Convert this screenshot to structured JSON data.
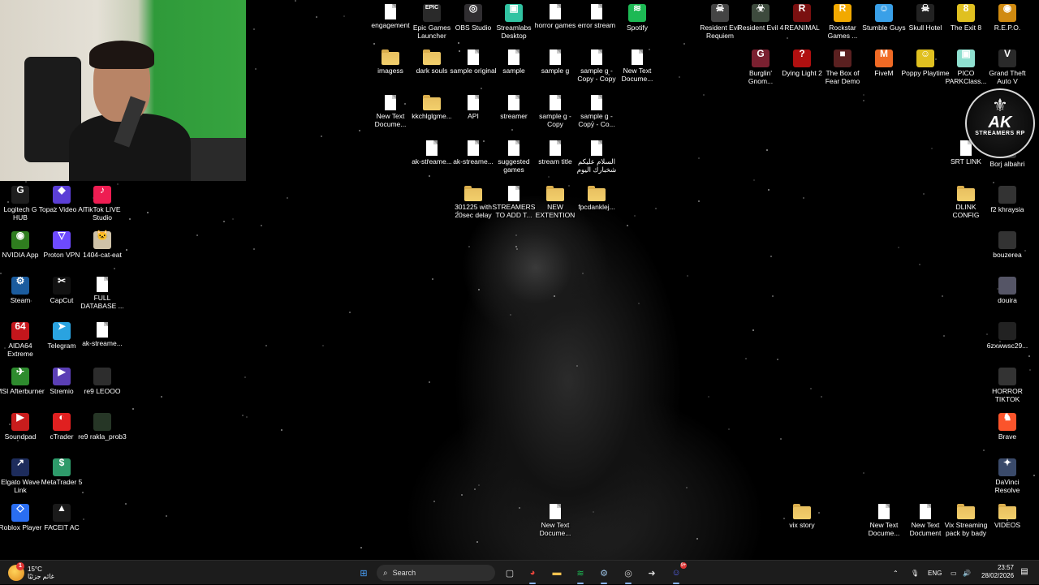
{
  "desktop": {
    "icons_left": [
      {
        "label": "Logitech G HUB",
        "icon": "logitech-icon",
        "color": "#1e1e1e",
        "glyph": "G"
      },
      {
        "label": "Topaz Video AI",
        "icon": "topaz-icon",
        "color": "#5b3fd6",
        "glyph": "◆"
      },
      {
        "label": "TikTok LIVE Studio",
        "icon": "tiktok-icon",
        "color": "#ee1d52",
        "glyph": "♪"
      },
      {
        "label": "NVIDIA App",
        "icon": "nvidia-icon",
        "color": "#2f7d1f",
        "glyph": "◉"
      },
      {
        "label": "Proton VPN",
        "icon": "proton-icon",
        "color": "#6d4aff",
        "glyph": "▽"
      },
      {
        "label": "1404-cat-eat",
        "icon": "image-icon",
        "color": "#cfc2a8",
        "glyph": "🐱"
      },
      {
        "label": "Steam",
        "icon": "steam-icon",
        "color": "#1b5c9e",
        "glyph": "⚙"
      },
      {
        "label": "CapCut",
        "icon": "capcut-icon",
        "color": "#111",
        "glyph": "✂"
      },
      {
        "label": "FULL DATABASE ...",
        "icon": "file-icon",
        "color": "",
        "glyph": ""
      },
      {
        "label": "AIDA64 Extreme",
        "icon": "aida-icon",
        "color": "#c4161c",
        "glyph": "64"
      },
      {
        "label": "Telegram",
        "icon": "telegram-icon",
        "color": "#2aa3e0",
        "glyph": "➤"
      },
      {
        "label": "ak-streame...",
        "icon": "file-icon",
        "color": "",
        "glyph": ""
      },
      {
        "label": "MSI Afterburner",
        "icon": "msi-icon",
        "color": "#2e8b2e",
        "glyph": "✈"
      },
      {
        "label": "Stremio",
        "icon": "stremio-icon",
        "color": "#5b3fb5",
        "glyph": "▶"
      },
      {
        "label": "re9 LEOOO",
        "icon": "image-icon",
        "color": "#2d2d2d",
        "glyph": ""
      },
      {
        "label": "Soundpad",
        "icon": "soundpad-icon",
        "color": "#c91d1d",
        "glyph": "▶"
      },
      {
        "label": "cTrader",
        "icon": "ctrader-icon",
        "color": "#e02020",
        "glyph": "◐"
      },
      {
        "label": "re9 rakla_prob3",
        "icon": "image-icon",
        "color": "#263626",
        "glyph": ""
      },
      {
        "label": "Elgato Wave Link",
        "icon": "elgato-icon",
        "color": "#1d2c5c",
        "glyph": "↗"
      },
      {
        "label": "MetaTrader 5",
        "icon": "metatrader-icon",
        "color": "#2e9a6a",
        "glyph": "$"
      },
      {
        "label": "Roblox Player",
        "icon": "roblox-icon",
        "color": "#2a6ef2",
        "glyph": "◇"
      },
      {
        "label": "FACEIT AC",
        "icon": "faceit-icon",
        "color": "#1a1a1a",
        "glyph": "▲"
      }
    ],
    "icons_middle": [
      {
        "label": "engagement",
        "icon": "file-icon",
        "type": "file"
      },
      {
        "label": "Epic Games Launcher",
        "icon": "epic-icon",
        "type": "app",
        "color": "#2a2a2a",
        "glyph": "EPIC"
      },
      {
        "label": "OBS Studio",
        "icon": "obs-icon",
        "type": "app",
        "color": "#302e31",
        "glyph": "◎"
      },
      {
        "label": "Streamlabs Desktop",
        "icon": "streamlabs-icon",
        "type": "app",
        "color": "#31c3a2",
        "glyph": "▣"
      },
      {
        "label": "horror games",
        "icon": "file-icon",
        "type": "file"
      },
      {
        "label": "error stream",
        "icon": "file-icon",
        "type": "file"
      },
      {
        "label": "Spotify",
        "icon": "spotify-icon",
        "type": "app",
        "color": "#1db954",
        "glyph": "≋"
      },
      {
        "label": "imagess",
        "icon": "folder-icon",
        "type": "folder"
      },
      {
        "label": "dark souls",
        "icon": "folder-icon",
        "type": "folder"
      },
      {
        "label": "sample original",
        "icon": "file-icon",
        "type": "file"
      },
      {
        "label": "sample",
        "icon": "file-icon",
        "type": "file"
      },
      {
        "label": "sample g",
        "icon": "file-icon",
        "type": "file"
      },
      {
        "label": "sample g - Copy - Copy",
        "icon": "file-icon",
        "type": "file"
      },
      {
        "label": "New Text Docume...",
        "icon": "file-icon",
        "type": "file"
      },
      {
        "label": "New Text Docume...",
        "icon": "file-icon",
        "type": "file"
      },
      {
        "label": "kkchlglgme...",
        "icon": "folder-icon",
        "type": "folder"
      },
      {
        "label": "API",
        "icon": "file-icon",
        "type": "file"
      },
      {
        "label": "streamer",
        "icon": "file-icon",
        "type": "file"
      },
      {
        "label": "sample g - Copy",
        "icon": "file-icon",
        "type": "file"
      },
      {
        "label": "sample g - Copy - Co...",
        "icon": "file-icon",
        "type": "file"
      },
      {
        "label": "ak-streame...",
        "icon": "file-icon",
        "type": "file"
      },
      {
        "label": "ak-streame...",
        "icon": "file-icon",
        "type": "file"
      },
      {
        "label": "suggested games",
        "icon": "file-icon",
        "type": "file"
      },
      {
        "label": "stream title",
        "icon": "file-icon",
        "type": "file"
      },
      {
        "label": "السلام عليكم شخبارك اليوم",
        "icon": "file-icon",
        "type": "file"
      },
      {
        "label": "301225 with 20sec delay",
        "icon": "folder-icon",
        "type": "folder"
      },
      {
        "label": "STREAMERS TO ADD T...",
        "icon": "file-icon",
        "type": "file"
      },
      {
        "label": "NEW EXTENTION",
        "icon": "folder-icon",
        "type": "folder"
      },
      {
        "label": "fpcdanklej...",
        "icon": "folder-icon",
        "type": "folder"
      },
      {
        "label": "New Text Docume...",
        "icon": "file-icon",
        "type": "file"
      }
    ],
    "icons_right": [
      {
        "label": "Resident Evil Requiem",
        "icon": "game-icon",
        "color": "#444",
        "glyph": "☠"
      },
      {
        "label": "Resident Evil 4",
        "icon": "game-icon",
        "color": "#3d4a3d",
        "glyph": "☣"
      },
      {
        "label": "REANIMAL",
        "icon": "game-icon",
        "color": "#7a1010",
        "glyph": "R"
      },
      {
        "label": "Rockstar Games ...",
        "icon": "rockstar-icon",
        "color": "#f2a900",
        "glyph": "R"
      },
      {
        "label": "Stumble Guys",
        "icon": "game-icon",
        "color": "#39a0e8",
        "glyph": "☺"
      },
      {
        "label": "Skull Hotel",
        "icon": "game-icon",
        "color": "#222",
        "glyph": "☠"
      },
      {
        "label": "The Exit 8",
        "icon": "game-icon",
        "color": "#e0c020",
        "glyph": "8"
      },
      {
        "label": "R.E.P.O.",
        "icon": "game-icon",
        "color": "#d08a10",
        "glyph": "◉"
      },
      {
        "label": "Burglin' Gnom...",
        "icon": "game-icon",
        "color": "#7a2030",
        "glyph": "G"
      },
      {
        "label": "Dying Light 2",
        "icon": "game-icon",
        "color": "#b01010",
        "glyph": "?"
      },
      {
        "label": "The Box of Fear Demo",
        "icon": "game-icon",
        "color": "#5a2020",
        "glyph": "■"
      },
      {
        "label": "FiveM",
        "icon": "fivem-icon",
        "color": "#f06a25",
        "glyph": "M"
      },
      {
        "label": "Poppy Playtime",
        "icon": "game-icon",
        "color": "#e0c020",
        "glyph": "☺"
      },
      {
        "label": "PICO PARKClass...",
        "icon": "game-icon",
        "color": "#8fe0d0",
        "glyph": "▣"
      },
      {
        "label": "Grand Theft Auto V",
        "icon": "game-icon",
        "color": "#2a2a2a",
        "glyph": "V"
      },
      {
        "label": "SRT LINK",
        "icon": "file-icon",
        "color": "",
        "glyph": ""
      },
      {
        "label": "Borj albahri",
        "icon": "image-icon",
        "color": "#333",
        "glyph": ""
      },
      {
        "label": "DLINK CONFIG",
        "icon": "folder-icon",
        "color": "",
        "glyph": ""
      },
      {
        "label": "f2 khraysia",
        "icon": "image-icon",
        "color": "#333",
        "glyph": ""
      },
      {
        "label": "bouzerea",
        "icon": "image-icon",
        "color": "#333",
        "glyph": ""
      },
      {
        "label": "douira",
        "icon": "image-icon",
        "color": "#556",
        "glyph": ""
      },
      {
        "label": "6zxwwsc29...",
        "icon": "image-icon",
        "color": "#222",
        "glyph": ""
      },
      {
        "label": "HORROR TIKTOK",
        "icon": "image-icon",
        "color": "#333",
        "glyph": ""
      },
      {
        "label": "Brave",
        "icon": "brave-icon",
        "color": "#fb542b",
        "glyph": "♞"
      },
      {
        "label": "DaVinci Resolve",
        "icon": "davinci-icon",
        "color": "#3a4a6a",
        "glyph": "✦"
      },
      {
        "label": "vix story",
        "icon": "folder-icon",
        "color": "",
        "glyph": ""
      },
      {
        "label": "New Text Docume...",
        "icon": "file-icon",
        "color": "",
        "glyph": ""
      },
      {
        "label": "New Text Document",
        "icon": "file-icon",
        "color": "",
        "glyph": ""
      },
      {
        "label": "Vix Streaming pack by bady",
        "icon": "folder-icon",
        "color": "",
        "glyph": ""
      },
      {
        "label": "VIDEOS",
        "icon": "folder-icon",
        "color": "",
        "glyph": ""
      }
    ],
    "ak_badge": {
      "title": "AK",
      "subtitle": "STREAMERS RP"
    }
  },
  "taskbar": {
    "weather": {
      "temp": "15°C",
      "condition": "غائم جزئيًا",
      "badge": "1"
    },
    "search_placeholder": "Search",
    "apps": [
      {
        "name": "start-button",
        "glyph": "⊞",
        "color": "#4aa3ff"
      },
      {
        "name": "task-view-icon",
        "glyph": "▢",
        "color": "#ddd"
      },
      {
        "name": "chrome-icon",
        "glyph": "◕",
        "color": "#e8453c"
      },
      {
        "name": "file-explorer-icon",
        "glyph": "▬",
        "color": "#f2c14e"
      },
      {
        "name": "spotify-icon",
        "glyph": "≋",
        "color": "#1db954"
      },
      {
        "name": "steam-icon",
        "glyph": "⚙",
        "color": "#9ec5e8"
      },
      {
        "name": "obs-icon",
        "glyph": "◎",
        "color": "#ccc"
      },
      {
        "name": "app-arrow-icon",
        "glyph": "➜",
        "color": "#ddd"
      },
      {
        "name": "discord-icon",
        "glyph": "☺",
        "color": "#5865f2"
      }
    ],
    "discord_badge": "9+",
    "lang": "ENG",
    "time": "23:57",
    "date": "28/02/2026"
  }
}
